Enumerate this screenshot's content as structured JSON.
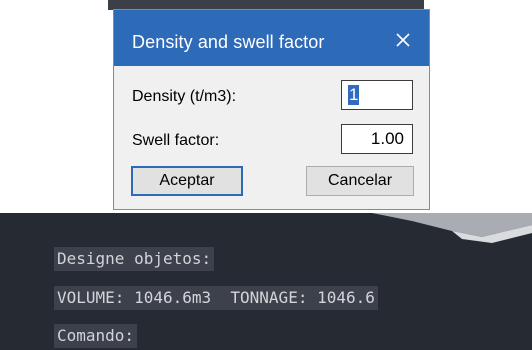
{
  "dialog": {
    "title": "Density and swell factor",
    "density_label": "Density (t/m3):",
    "density_value": "1",
    "swell_label": "Swell factor:",
    "swell_value": "1.00",
    "ok_label": "Aceptar",
    "cancel_label": "Cancelar",
    "close_icon": "close-icon"
  },
  "console": {
    "line1": "Designe objetos:",
    "line2": "VOLUME: 1046.6m3  TONNAGE: 1046.6",
    "line3": "Comando:"
  },
  "colors": {
    "titlebar": "#2d6ab8",
    "console_bg": "#252a33",
    "console_line_bg": "#3c414b"
  }
}
